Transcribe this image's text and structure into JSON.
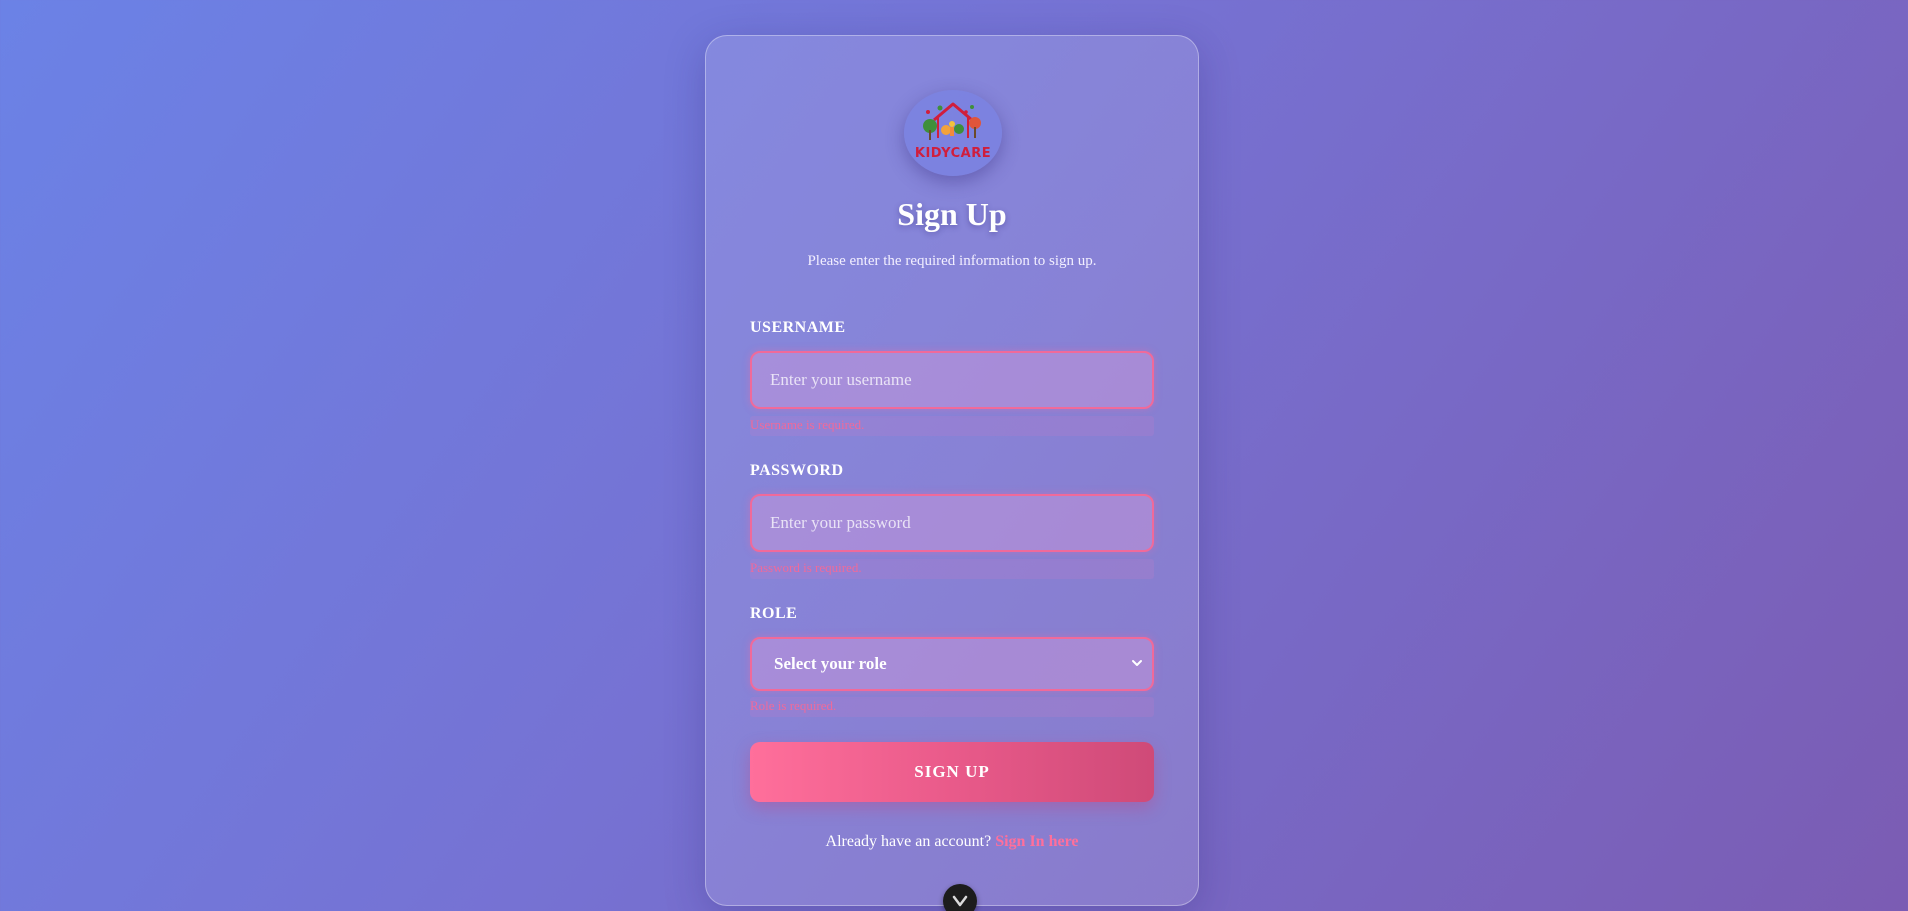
{
  "brand": {
    "logo_text": "KIDYCARE",
    "logo_icon": "kidycare-house-trees-logo",
    "accent": "#ff6f9b"
  },
  "header": {
    "title": "Sign Up",
    "subtitle": "Please enter the required information to sign up."
  },
  "form": {
    "username": {
      "label": "USERNAME",
      "placeholder": "Enter your username",
      "value": "",
      "error": "Username is required."
    },
    "password": {
      "label": "PASSWORD",
      "placeholder": "Enter your password",
      "value": "",
      "error": "Password is required."
    },
    "role": {
      "label": "ROLE",
      "selected": "Select your role",
      "error": "Role is required."
    },
    "submit_label": "SIGN UP"
  },
  "footer": {
    "prompt": "Already have an account?",
    "link_label": "Sign In here"
  },
  "floating_button": {
    "icon": "chevron-down-icon"
  },
  "colors": {
    "error": "#f06a9a",
    "button_start": "#ff6f9b",
    "button_end": "#cf4a78"
  }
}
